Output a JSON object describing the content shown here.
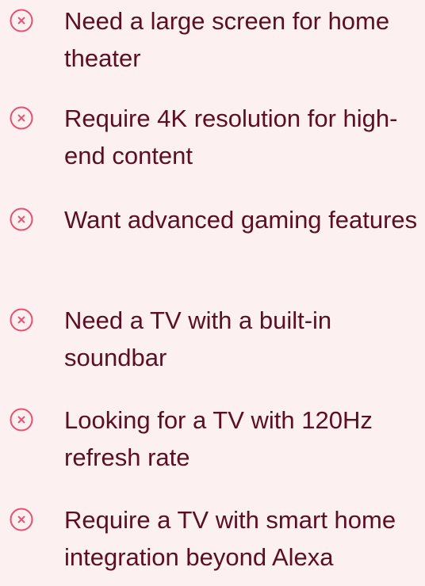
{
  "theme": {
    "background": "#fdf0f1",
    "text_color": "#5a0f24",
    "icon_color": "#e8506e"
  },
  "reasons_list": {
    "icon": "close-circle-icon",
    "items": [
      {
        "label": "Need a large screen for home theater"
      },
      {
        "label": "Require 4K resolution for high-end content"
      },
      {
        "label": "Want advanced gaming features"
      },
      {
        "label": "Need a TV with a built-in soundbar"
      },
      {
        "label": "Looking for a TV with 120Hz refresh rate"
      },
      {
        "label": "Require a TV with smart home integration beyond Alexa"
      }
    ]
  }
}
